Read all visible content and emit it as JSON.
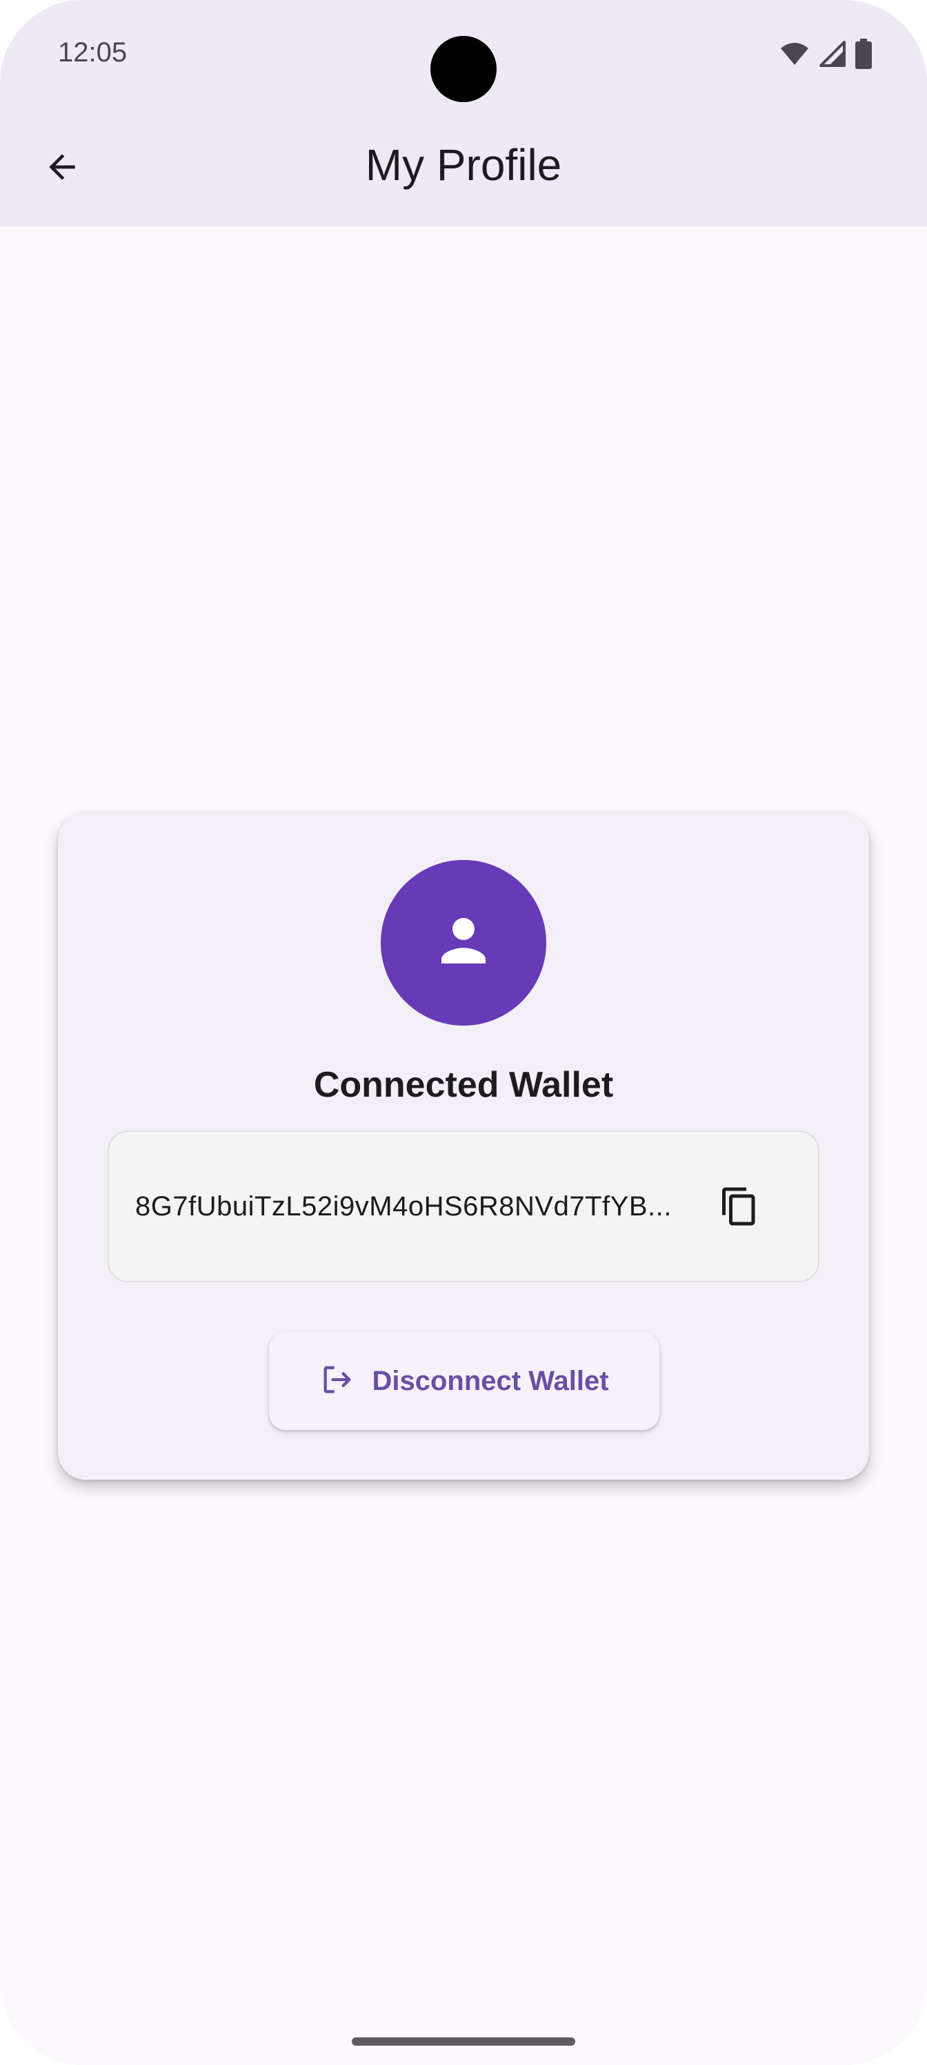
{
  "status_bar": {
    "time": "12:05",
    "icons": [
      "wifi-icon",
      "cellular-signal-icon",
      "battery-icon"
    ]
  },
  "app_bar": {
    "back_icon": "arrow-back-icon",
    "title": "My Profile"
  },
  "profile_card": {
    "avatar_icon": "person-icon",
    "heading": "Connected Wallet",
    "wallet_address": "8G7fUbuiTzL52i9vM4oHS6R8NVd7TfYB...",
    "copy_icon": "copy-icon",
    "disconnect_button": {
      "icon": "logout-icon",
      "label": "Disconnect Wallet"
    }
  },
  "colors": {
    "accent": "#673ab7",
    "button_text": "#6750a4",
    "app_bar_bg": "#efe8f6",
    "page_bg": "#fdf7fe",
    "card_bg": "#f3eff6"
  }
}
